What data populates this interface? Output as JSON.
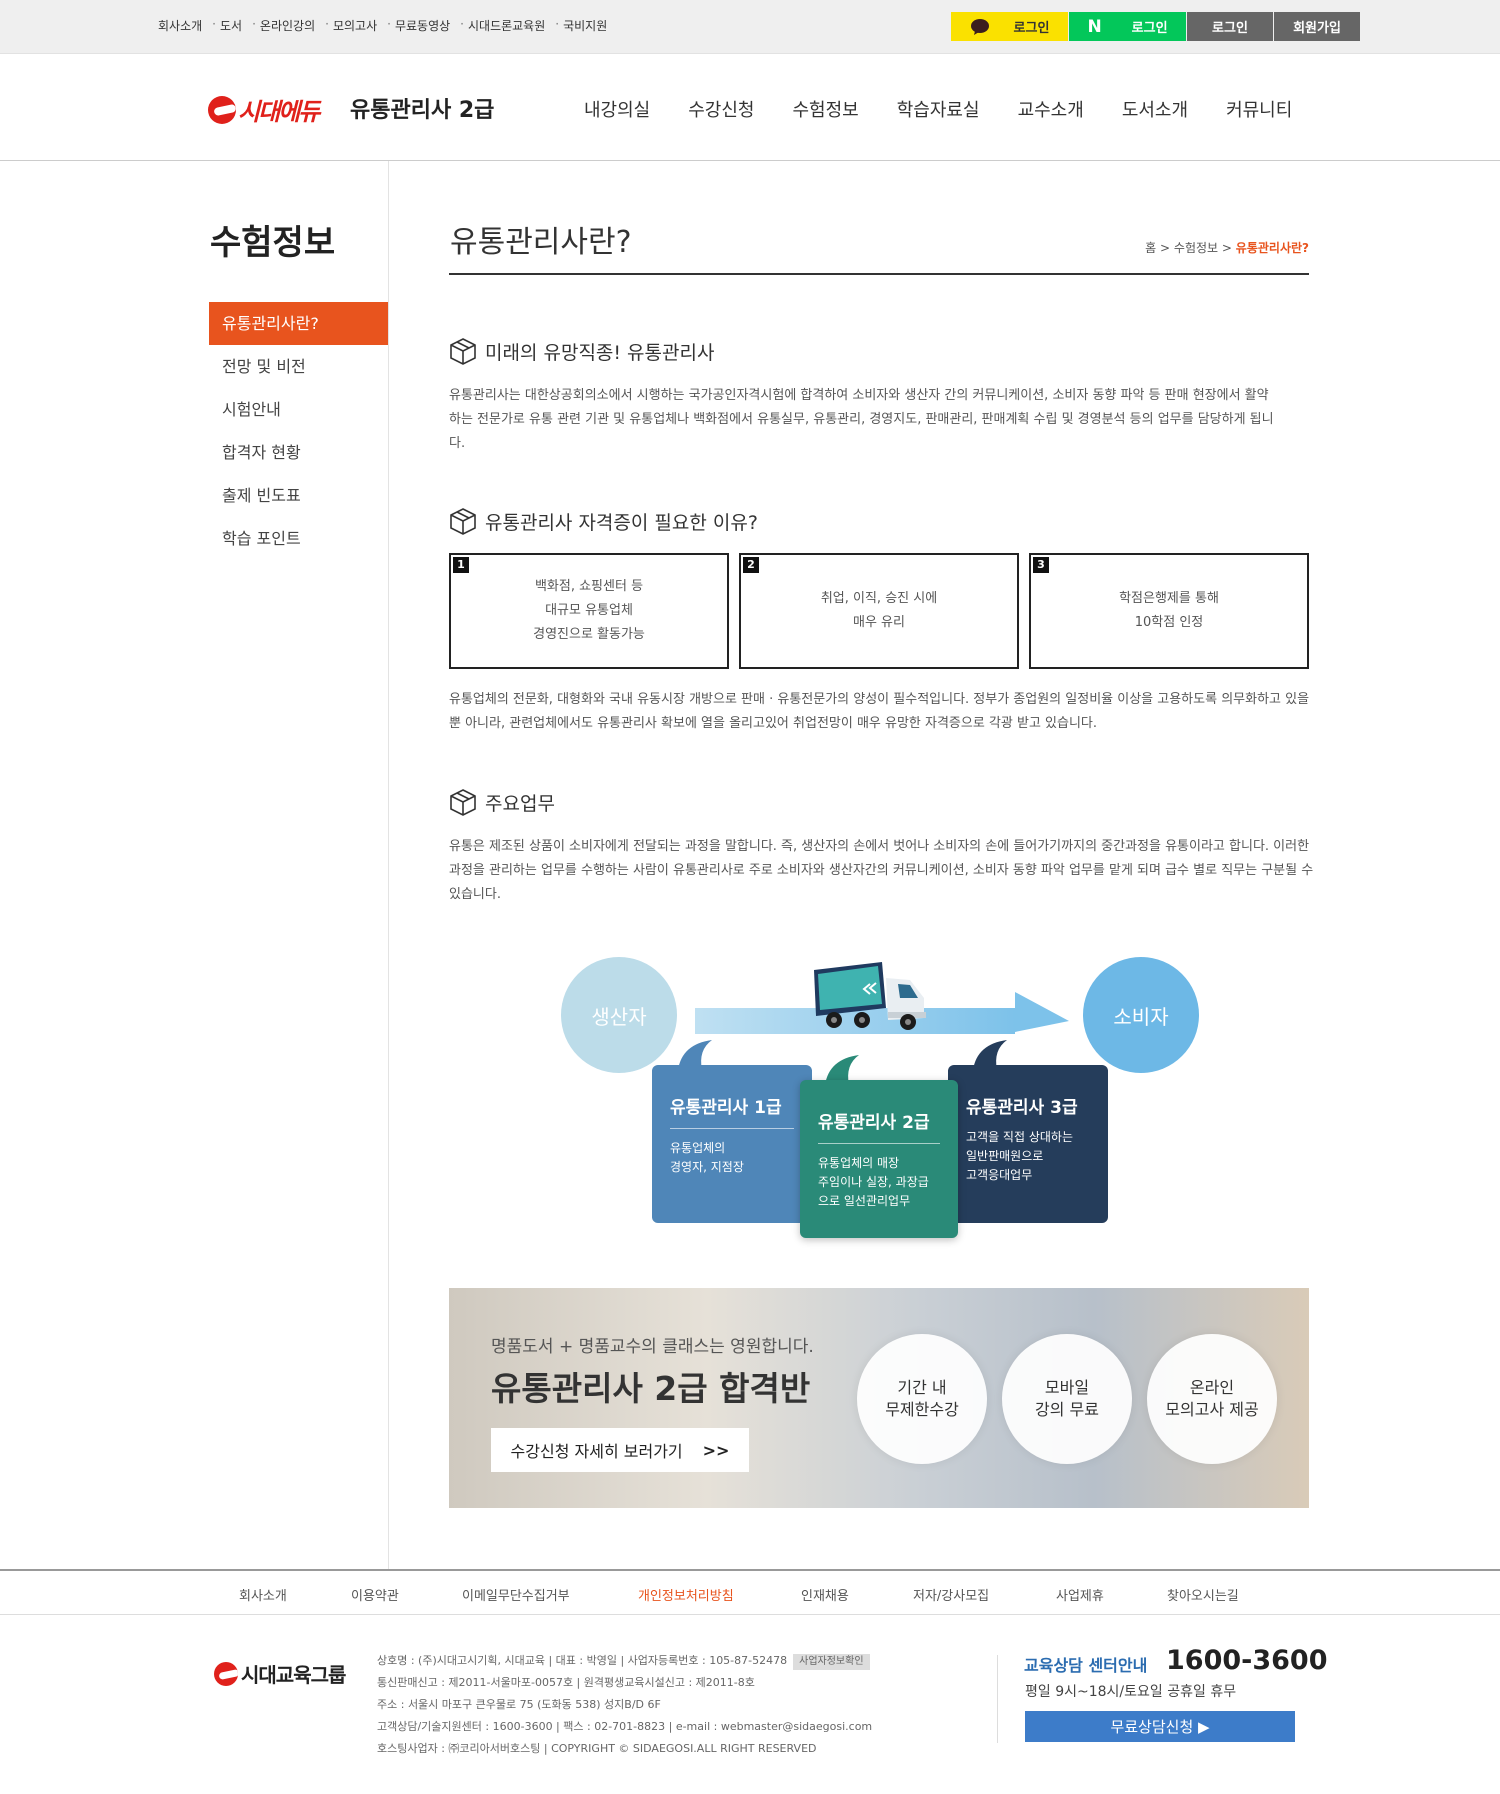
{
  "top": {
    "links": [
      "회사소개",
      "도서",
      "온라인강의",
      "모의고사",
      "무료동영상",
      "시대드론교육원",
      "국비지원"
    ],
    "kakao_login": "로그인",
    "naver_login": "로그인",
    "login": "로그인",
    "join": "회원가입"
  },
  "header": {
    "logo": "시대에듀",
    "site_title": "유통관리사 2급",
    "nav": [
      "내강의실",
      "수강신청",
      "수험정보",
      "학습자료실",
      "교수소개",
      "도서소개",
      "커뮤니티"
    ]
  },
  "sidebar": {
    "title": "수험정보",
    "items": [
      "유통관리사란?",
      "전망 및 비전",
      "시험안내",
      "합격자 현황",
      "출제 빈도표",
      "학습 포인트"
    ],
    "active_index": 0
  },
  "content": {
    "title": "유통관리사란?",
    "breadcrumb": {
      "home": "홈",
      "sep": ">",
      "parent": "수험정보",
      "current": "유통관리사란?"
    },
    "sections": [
      {
        "heading": "미래의 유망직종! 유통관리사",
        "text": "유통관리사는 대한상공회의소에서 시행하는 국가공인자격시험에 합격하여 소비자와 생산자 간의 커뮤니케이션, 소비자 동향 파악 등 판매 현장에서 활약하는 전문가로 유통 관련 기관 및 유통업체나 백화점에서 유통실무, 유통관리, 경영지도, 판매관리, 판매계획 수립 및 경영분석 등의 업무를 담당하게 됩니다."
      },
      {
        "heading": "유통관리사 자격증이 필요한 이유?",
        "reasons": [
          {
            "num": "1",
            "text": "백화점, 쇼핑센터 등\n대규모 유통업체\n경영진으로 활동가능"
          },
          {
            "num": "2",
            "text": "취업, 이직, 승진 시에\n매우 유리"
          },
          {
            "num": "3",
            "text": "학점은행제를 통해\n10학점 인정"
          }
        ],
        "text": "유통업체의 전문화, 대형화와 국내 유동시장 개방으로 판매 · 유통전문가의 양성이 필수적입니다. 정부가 종업원의 일정비율 이상을 고용하도록 의무화하고 있을 뿐 아니라, 관련업체에서도 유통관리사 확보에 열을 올리고있어 취업전망이 매우 유망한 자격증으로 각광 받고 있습니다."
      },
      {
        "heading": "주요업무",
        "text": "유통은 제조된 상품이 소비자에게 전달되는 과정을 말합니다. 즉, 생산자의 손에서 벗어나 소비자의 손에 들어가기까지의 중간과정을 유통이라고 합니다. 이러한 과정을 관리하는 업무를 수행하는 사람이 유통관리사로 주로 소비자와 생산자간의 커뮤니케이션, 소비자 동향 파악 업무를 맡게 되며 급수 별로 직무는 구분될 수 있습니다."
      }
    ],
    "diagram": {
      "producer": "생산자",
      "consumer": "소비자",
      "grades": [
        {
          "title": "유통관리사 1급",
          "desc": "유통업체의\n경영자, 지점장"
        },
        {
          "title": "유통관리사 2급",
          "desc": "유통업체의 매장\n주임이나 실장, 과장급\n으로 일선관리업무"
        },
        {
          "title": "유통관리사 3급",
          "desc": "고객을 직접 상대하는\n일반판매원으로\n고객응대업무"
        }
      ]
    }
  },
  "banner": {
    "sub": "명품도서 + 명품교수의 클래스는 영원합니다.",
    "title": "유통관리사 2급 합격반",
    "button": "수강신청 자세히 보러가기",
    "features": [
      "기간 내\n무제한수강",
      "모바일\n강의 무료",
      "온라인\n모의고사 제공"
    ]
  },
  "footer": {
    "links": [
      "회사소개",
      "이용약관",
      "이메일무단수집거부",
      "개인정보처리방침",
      "인재채용",
      "저자/강사모집",
      "사업제휴",
      "찾아오시는길"
    ],
    "logo": "시대교육그룹",
    "info": [
      "상호명 : (주)시대고시기획, 시대교육 | 대표 : 박영일 | 사업자등록번호 : 105-87-52478",
      "통신판매신고 : 제2011-서울마포-0057호 | 원격평생교육시설신고 : 제2011-8호",
      "주소 : 서울시 마포구 큰우물로 75 (도화동 538) 성지B/D 6F",
      "고객상담/기술지원센터 : 1600-3600 | 팩스 : 02-701-8823 | e-mail : webmaster@sidaegosi.com",
      "호스팅사업자 : ㈜코리아서버호스팅 | COPYRIGHT © SIDAEGOSI.ALL RIGHT RESERVED"
    ],
    "biz_tag": "사업자정보확인",
    "cs_label": "교육상담 센터안내",
    "cs_phone": "1600-3600",
    "cs_hours": "평일 9시~18시/토요일 공휴일 휴무",
    "cs_button": "무료상담신청 ▶"
  },
  "colors": {
    "accent": "#e8541e",
    "kakao": "#fae100",
    "naver": "#03c75a",
    "grade1": "#4f86b8",
    "grade2": "#2a8a78",
    "grade3": "#253d5b"
  }
}
